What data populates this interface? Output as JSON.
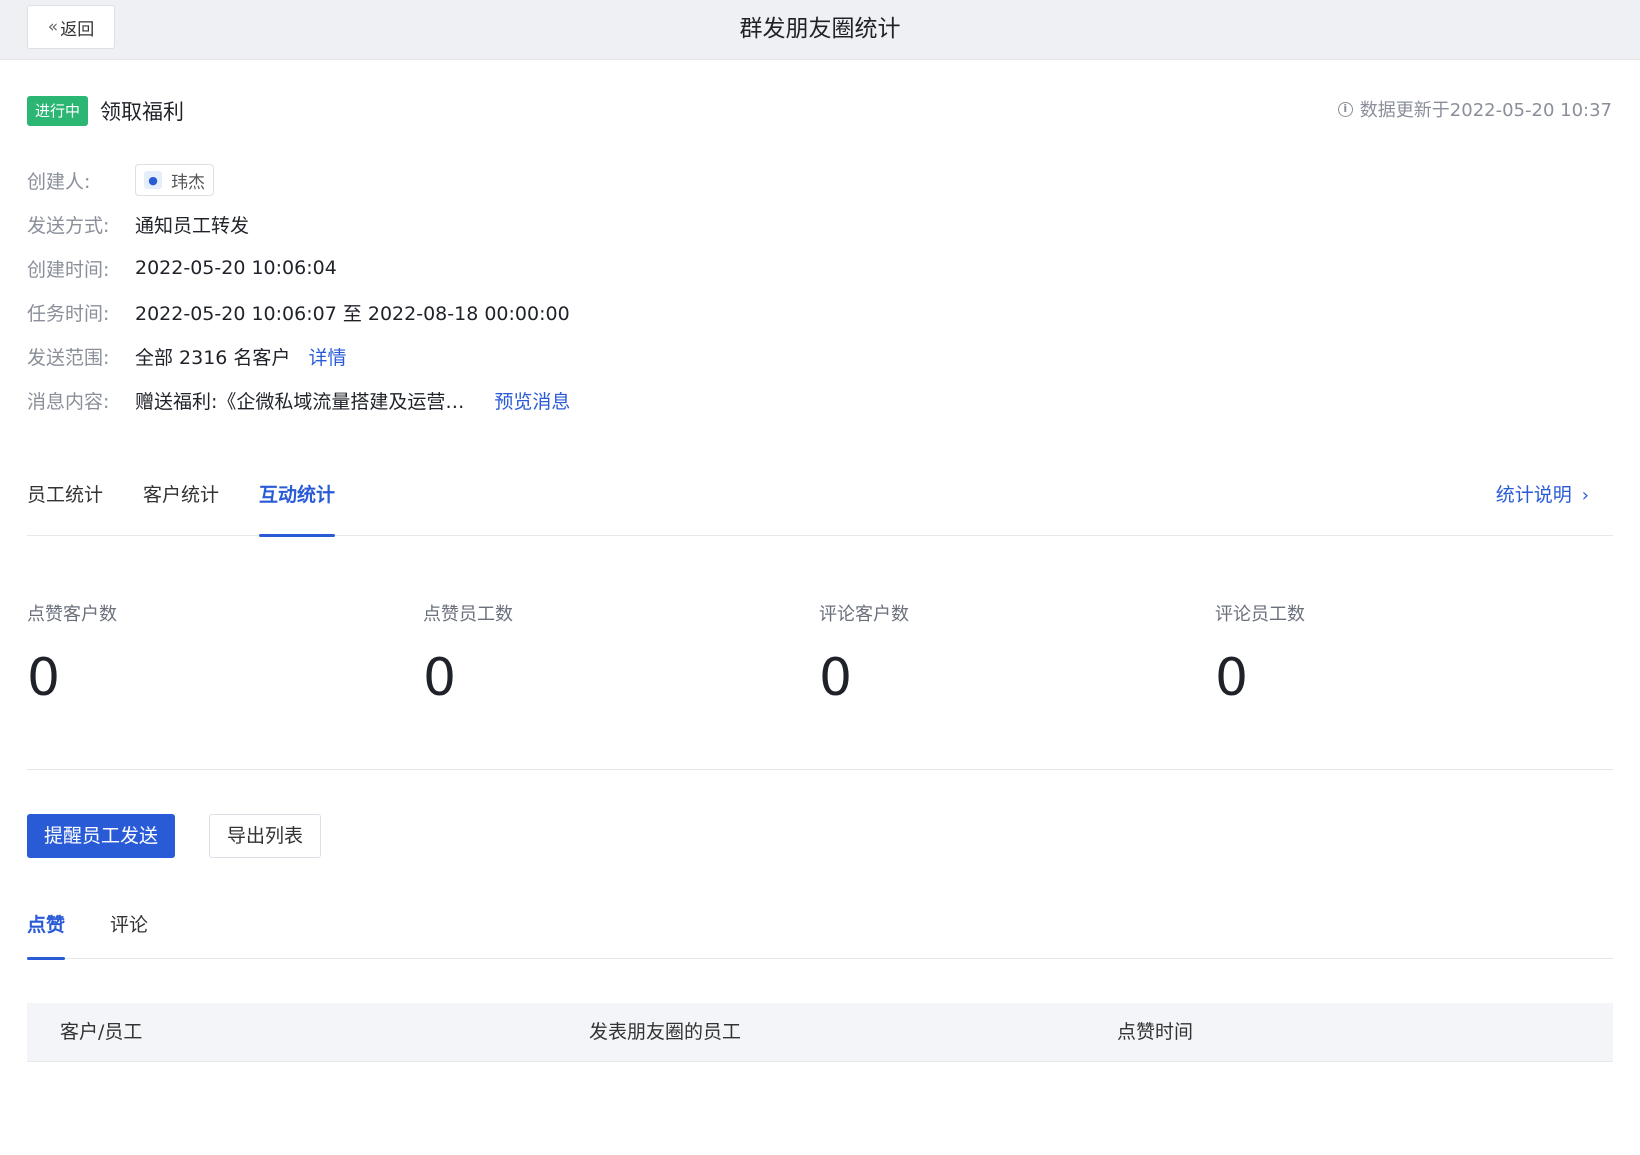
{
  "header": {
    "back_label": "返回",
    "title": "群发朋友圈统计"
  },
  "task": {
    "status": "进行中",
    "status_color": "#2bb673",
    "name": "领取福利",
    "updated_text": "数据更新于2022-05-20 10:37"
  },
  "meta": {
    "creator_key": "创建人:",
    "creator_name": "玮杰",
    "send_mode_key": "发送方式:",
    "send_mode": "通知员工转发",
    "created_key": "创建时间:",
    "created_at": "2022-05-20 10:06:04",
    "task_time_key": "任务时间:",
    "task_time": "2022-05-20 10:06:07 至 2022-08-18 00:00:00",
    "range_key": "发送范围:",
    "range": "全部 2316 名客户",
    "range_link": "详情",
    "content_key": "消息内容:",
    "content": "赠送福利:《企微私域流量搭建及运营…",
    "content_link": "预览消息"
  },
  "stat_tabs": {
    "items": [
      {
        "label": "员工统计"
      },
      {
        "label": "客户统计"
      },
      {
        "label": "互动统计"
      }
    ],
    "active_index": 2,
    "explain_label": "统计说明"
  },
  "stats": [
    {
      "label": "点赞客户数",
      "value": "0"
    },
    {
      "label": "点赞员工数",
      "value": "0"
    },
    {
      "label": "评论客户数",
      "value": "0"
    },
    {
      "label": "评论员工数",
      "value": "0"
    }
  ],
  "actions": {
    "remind_label": "提醒员工发送",
    "export_label": "导出列表"
  },
  "list_tabs": {
    "items": [
      {
        "label": "点赞"
      },
      {
        "label": "评论"
      }
    ],
    "active_index": 0
  },
  "table": {
    "columns": [
      "客户/员工",
      "发表朋友圈的员工",
      "点赞时间"
    ]
  },
  "colors": {
    "accent": "#2a5bd7",
    "status_green": "#2bb673"
  }
}
